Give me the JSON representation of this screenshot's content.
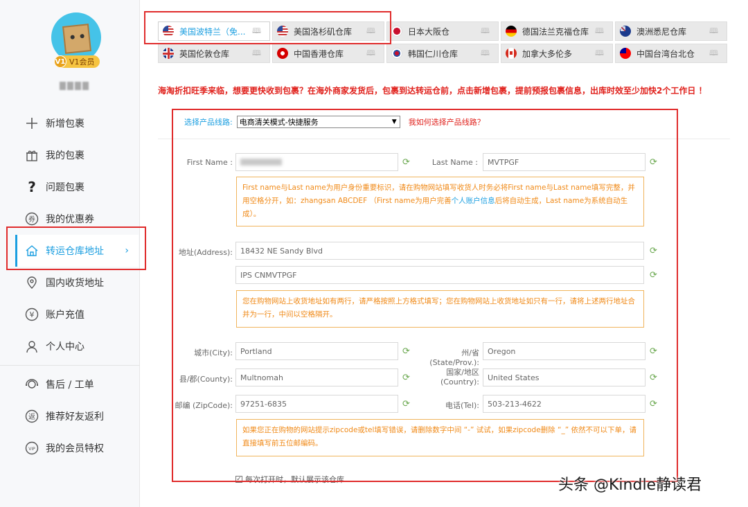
{
  "sidebar": {
    "vip_badge": "V1会员",
    "vip_level": "V1",
    "username": "",
    "items": [
      {
        "label": "新增包裹",
        "icon": "plus-icon"
      },
      {
        "label": "我的包裹",
        "icon": "gift-icon"
      },
      {
        "label": "问题包裹",
        "icon": "question-icon"
      },
      {
        "label": "我的优惠券",
        "icon": "coupon-icon"
      },
      {
        "label": "转运仓库地址",
        "icon": "home-icon",
        "active": true
      },
      {
        "label": "国内收货地址",
        "icon": "location-pin-icon"
      },
      {
        "label": "账户充值",
        "icon": "yen-icon"
      },
      {
        "label": "个人中心",
        "icon": "user-icon"
      },
      {
        "label": "售后 / 工单",
        "icon": "service-icon"
      },
      {
        "label": "推荐好友返利",
        "icon": "rebate-icon"
      },
      {
        "label": "我的会员特权",
        "icon": "vip-icon"
      }
    ]
  },
  "tabs": [
    {
      "label": "美国波特兰（免...",
      "active": true
    },
    {
      "label": "美国洛杉矶仓库"
    },
    {
      "label": "日本大阪仓"
    },
    {
      "label": "德国法兰克福仓库"
    },
    {
      "label": "澳洲悉尼仓库"
    },
    {
      "label": "英国伦敦仓库"
    },
    {
      "label": "中国香港仓库"
    },
    {
      "label": "韩国仁川仓库"
    },
    {
      "label": "加拿大多伦多"
    },
    {
      "label": "中国台湾台北仓"
    }
  ],
  "notice": "海淘折扣旺季来临，想要更快收到包裹？在海外商家发货后，包裹到达转运仓前，点击新增包裹，提前预报包裹信息，出库时效至少加快2个工作日 ！",
  "form": {
    "route_label": "选择产品线路:",
    "route_value": "电商清关模式-快捷服务",
    "route_help": "我如何选择产品线路？",
    "first_name_label": "First Name :",
    "first_name_value": "",
    "last_name_label": "Last Name :",
    "last_name_value": "MVTPGF",
    "name_tip_1": "First name与Last name为用户身份重要标识，请在购物网站填写收货人时务必将First name与Last name填写完整，并用空格分开，如：zhangsan ABCDEF （First name为用户完善",
    "name_tip_link": "个人账户信息",
    "name_tip_2": "后将自动生成，Last name为系统自动生成）。",
    "address_label": "地址(Address):",
    "address_1": "18432 NE Sandy Blvd",
    "address_2": "IPS CNMVTPGF",
    "address_tip": "您在购物网站上收货地址如有两行，请严格按照上方格式填写；您在购物网站上收货地址如只有一行，请将上述两行地址合并为一行，中间以空格隔开。",
    "city_label": "城市(City):",
    "city_value": "Portland",
    "state_label": "州/省(State/Prov.):",
    "state_value": "Oregon",
    "county_label": "县/郡(County):",
    "county_value": "Multnomah",
    "country_label_1": "国家/地区",
    "country_label_2": "(Country):",
    "country_value": "United States",
    "zip_label": "邮编 (ZipCode):",
    "zip_value": "97251-6835",
    "tel_label": "电话(Tel):",
    "tel_value": "503-213-4622",
    "zip_tip": "如果您正在购物的网站提示zipcode或tel填写错误，请删除数字中间 “-” 试试，如果zipcode删除 “_” 依然不可以下单，请直接填写前五位邮编码。",
    "checkbox_label": "每次打开时，默认展示该仓库"
  },
  "watermark": "头条 @Kindle静读君",
  "colors": {
    "accent": "#1a9ee0",
    "alert": "#e0211c",
    "tip_border": "#f0b45c",
    "tip_text": "#f08a18",
    "highlight_frame": "#e02b2b"
  }
}
